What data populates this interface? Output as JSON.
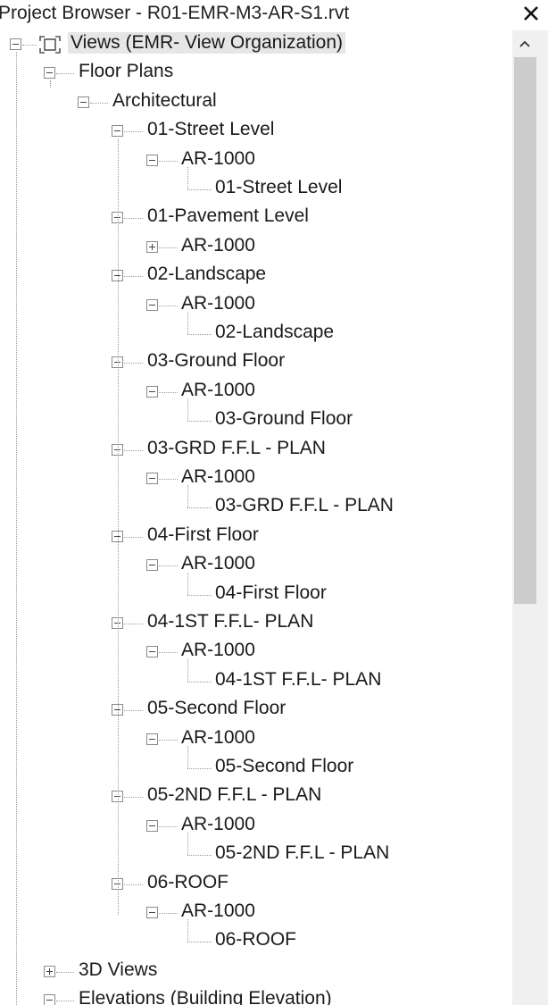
{
  "window": {
    "title": "Project Browser - R01-EMR-M3-AR-S1.rvt",
    "close_icon": "close-icon"
  },
  "tree": {
    "root_label": "Views (EMR- View Organization)",
    "floor_plans_label": "Floor Plans",
    "architectural_label": "Architectural",
    "levels": [
      {
        "name": "01-Street Level",
        "sheet": "AR-1000",
        "view": "01-Street Level",
        "sheet_expanded": true
      },
      {
        "name": "01-Pavement Level",
        "sheet": "AR-1000",
        "view": "",
        "sheet_expanded": false
      },
      {
        "name": "02-Landscape",
        "sheet": "AR-1000",
        "view": "02-Landscape",
        "sheet_expanded": true
      },
      {
        "name": "03-Ground Floor",
        "sheet": "AR-1000",
        "view": "03-Ground Floor",
        "sheet_expanded": true
      },
      {
        "name": "03-GRD F.F.L - PLAN",
        "sheet": "AR-1000",
        "view": "03-GRD F.F.L - PLAN",
        "sheet_expanded": true
      },
      {
        "name": "04-First Floor",
        "sheet": "AR-1000",
        "view": "04-First Floor",
        "sheet_expanded": true
      },
      {
        "name": "04-1ST F.F.L- PLAN",
        "sheet": "AR-1000",
        "view": "04-1ST F.F.L- PLAN",
        "sheet_expanded": true
      },
      {
        "name": "05-Second Floor",
        "sheet": "AR-1000",
        "view": "05-Second Floor",
        "sheet_expanded": true
      },
      {
        "name": "05-2ND F.F.L - PLAN",
        "sheet": "AR-1000",
        "view": "05-2ND F.F.L - PLAN",
        "sheet_expanded": true
      },
      {
        "name": "06-ROOF",
        "sheet": "AR-1000",
        "view": "06-ROOF",
        "sheet_expanded": true
      }
    ],
    "three_d_label": "3D Views",
    "elevations_label": "Elevations (Building Elevation)"
  },
  "scrollbar": {
    "up_icon": "chevron-up-icon"
  }
}
